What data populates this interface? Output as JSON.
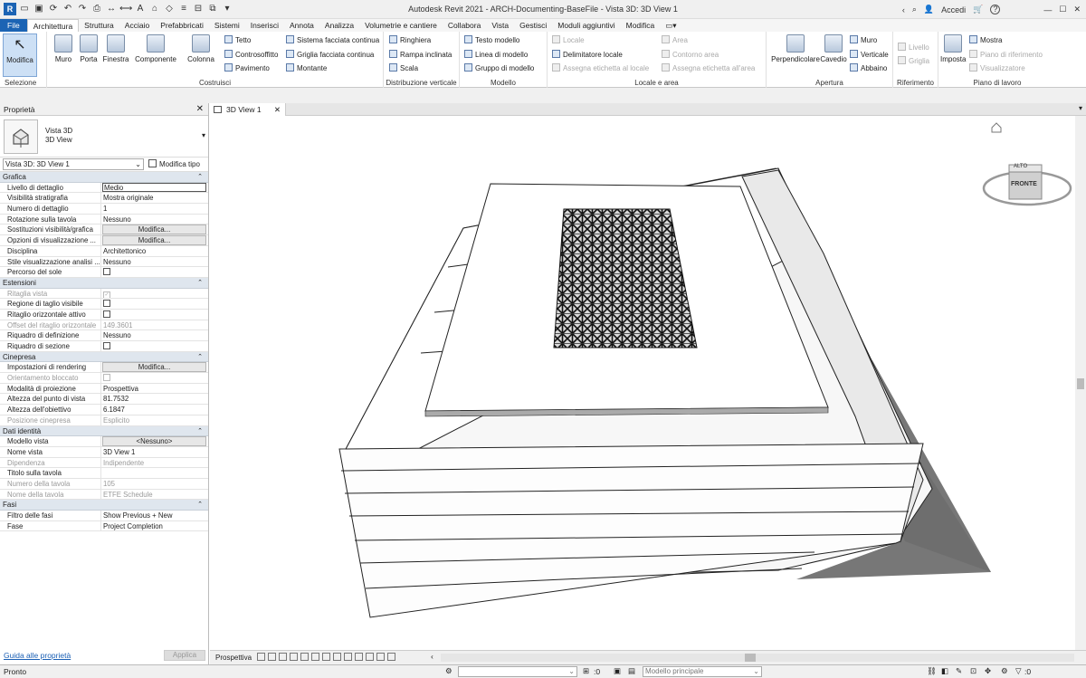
{
  "app_title": "Autodesk Revit 2021 - ARCH-Documenting-BaseFile - Vista 3D: 3D View 1",
  "account": {
    "signin_label": "Accedi",
    "help_label": "?"
  },
  "tabs": [
    "File",
    "Architettura",
    "Struttura",
    "Acciaio",
    "Prefabbricati",
    "Sistemi",
    "Inserisci",
    "Annota",
    "Analizza",
    "Volumetrie e cantiere",
    "Collabora",
    "Vista",
    "Gestisci",
    "Moduli aggiuntivi",
    "Modifica"
  ],
  "active_tab": "Architettura",
  "ribbon": {
    "select": {
      "button": "Modifica",
      "label": "Selezione"
    },
    "build": {
      "label": "Costruisci",
      "big": [
        "Muro",
        "Porta",
        "Finestra",
        "Componente",
        "Colonna"
      ],
      "small": [
        "Tetto",
        "Controsoffitto",
        "Pavimento",
        "Sistema facciata continua",
        "Griglia facciata continua",
        "Montante"
      ]
    },
    "circulation": {
      "label": "Distribuzione verticale",
      "items": [
        "Ringhiera",
        "Rampa inclinata",
        "Scala"
      ]
    },
    "model": {
      "label": "Modello",
      "items": [
        "Testo modello",
        "Linea di modello",
        "Gruppo di modello"
      ]
    },
    "room": {
      "label": "Locale e area",
      "items": [
        "Locale",
        "Delimitatore locale",
        "Assegna etichetta al locale",
        "Area",
        "Contorno area",
        "Assegna etichetta all'area"
      ]
    },
    "opening": {
      "label": "Apertura",
      "big": [
        "Perpendicolare",
        "Cavedio"
      ],
      "small": [
        "Muro",
        "Verticale",
        "Abbaino"
      ]
    },
    "datum": {
      "label": "Riferimento",
      "items": [
        "Livello",
        "Griglia"
      ]
    },
    "workplane": {
      "label": "Piano di lavoro",
      "big": "Imposta",
      "small": [
        "Mostra",
        "Piano di riferimento",
        "Visualizzatore"
      ]
    }
  },
  "properties": {
    "title": "Proprietà",
    "type_line1": "Vista 3D",
    "type_line2": "3D View",
    "instance": "Vista 3D: 3D View 1",
    "edit_type": "Modifica tipo",
    "groups": [
      {
        "name": "Grafica",
        "rows": [
          {
            "n": "Livello di dettaglio",
            "v": "Medio",
            "kind": "box"
          },
          {
            "n": "Visibilità stratigrafia",
            "v": "Mostra originale"
          },
          {
            "n": "Numero di dettaglio",
            "v": "1"
          },
          {
            "n": "Rotazione sulla tavola",
            "v": "Nessuno"
          },
          {
            "n": "Sostituzioni visibilità/grafica",
            "v": "Modifica...",
            "kind": "btn"
          },
          {
            "n": "Opzioni di visualizzazione ...",
            "v": "Modifica...",
            "kind": "btn"
          },
          {
            "n": "Disciplina",
            "v": "Architettonico"
          },
          {
            "n": "Stile visualizzazione analisi ...",
            "v": "Nessuno"
          },
          {
            "n": "Percorso del sole",
            "v": "",
            "kind": "cb"
          }
        ]
      },
      {
        "name": "Estensioni",
        "rows": [
          {
            "n": "Ritaglia vista",
            "v": "✓",
            "kind": "cb",
            "dim": true
          },
          {
            "n": "Regione di taglio visibile",
            "v": "",
            "kind": "cb"
          },
          {
            "n": "Ritaglio orizzontale attivo",
            "v": "",
            "kind": "cb"
          },
          {
            "n": "Offset del ritaglio orizzontale",
            "v": "149.3601",
            "dim": true
          },
          {
            "n": "Riquadro di definizione",
            "v": "Nessuno"
          },
          {
            "n": "Riquadro di sezione",
            "v": "",
            "kind": "cb"
          }
        ]
      },
      {
        "name": "Cinepresa",
        "rows": [
          {
            "n": "Impostazioni di rendering",
            "v": "Modifica...",
            "kind": "btn"
          },
          {
            "n": "Orientamento bloccato",
            "v": "",
            "kind": "cb",
            "dim": true
          },
          {
            "n": "Modalità di proiezione",
            "v": "Prospettiva"
          },
          {
            "n": "Altezza del punto di vista",
            "v": "81.7532"
          },
          {
            "n": "Altezza dell'obiettivo",
            "v": "6.1847"
          },
          {
            "n": "Posizione cinepresa",
            "v": "Esplicito",
            "dim": true
          }
        ]
      },
      {
        "name": "Dati identità",
        "rows": [
          {
            "n": "Modello vista",
            "v": "<Nessuno>",
            "kind": "btn"
          },
          {
            "n": "Nome vista",
            "v": "3D View 1"
          },
          {
            "n": "Dipendenza",
            "v": "Indipendente",
            "dim": true
          },
          {
            "n": "Titolo sulla tavola",
            "v": ""
          },
          {
            "n": "Numero della tavola",
            "v": "105",
            "dim": true
          },
          {
            "n": "Nome della tavola",
            "v": "ETFE Schedule",
            "dim": true
          }
        ]
      },
      {
        "name": "Fasi",
        "rows": [
          {
            "n": "Filtro delle fasi",
            "v": "Show Previous + New"
          },
          {
            "n": "Fase",
            "v": "Project Completion"
          }
        ]
      }
    ],
    "help_link": "Guida alle proprietà",
    "apply": "Applica"
  },
  "view": {
    "tab_label": "3D View 1",
    "viewcube_top": "ALTO",
    "viewcube_front": "FRONTE",
    "view_control_label": "Prospettiva"
  },
  "status": {
    "text": "Pronto",
    "count": ":0",
    "model": "Modello principale",
    "filter_count": ":0"
  }
}
